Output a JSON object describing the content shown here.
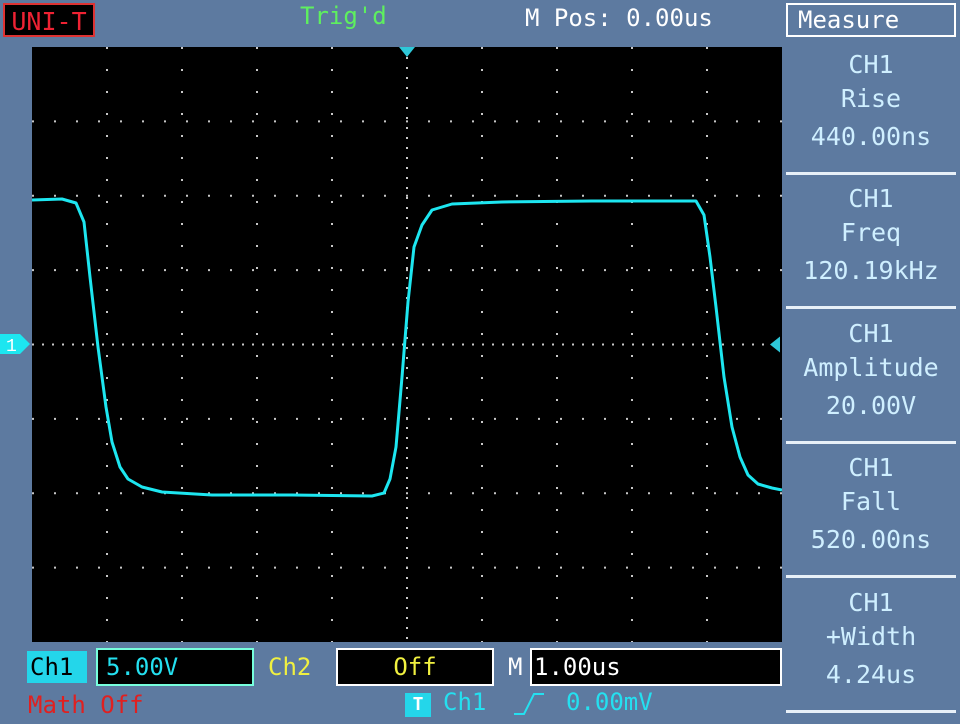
{
  "brand": "UNI-T",
  "status": {
    "trigger": "Trig'd",
    "mpos": "M Pos: 0.00us"
  },
  "panel": {
    "title": "Measure",
    "items": [
      {
        "channel": "CH1",
        "name": "Rise",
        "value": "440.00ns"
      },
      {
        "channel": "CH1",
        "name": "Freq",
        "value": "120.19kHz"
      },
      {
        "channel": "CH1",
        "name": "Amplitude",
        "value": "20.00V"
      },
      {
        "channel": "CH1",
        "name": "Fall",
        "value": "520.00ns"
      },
      {
        "channel": "CH1",
        "name": "+Width",
        "value": "4.24us"
      }
    ]
  },
  "bottom": {
    "ch1_label": "Ch1",
    "ch1_scale": "5.00V",
    "ch2_label": "Ch2",
    "ch2_state": "Off",
    "time_label": "M",
    "time_scale": "1.00us",
    "math": "Math Off",
    "trigger_icon": "T",
    "trigger_source": "Ch1",
    "trigger_edge_icon": "rising-edge-icon",
    "trigger_level": "0.00mV"
  },
  "ch1_marker": "1",
  "colors": {
    "trace": "#1de6f0",
    "grid": "#c8c8c8",
    "screen": "#000000",
    "background": "#5d7aa0"
  }
}
